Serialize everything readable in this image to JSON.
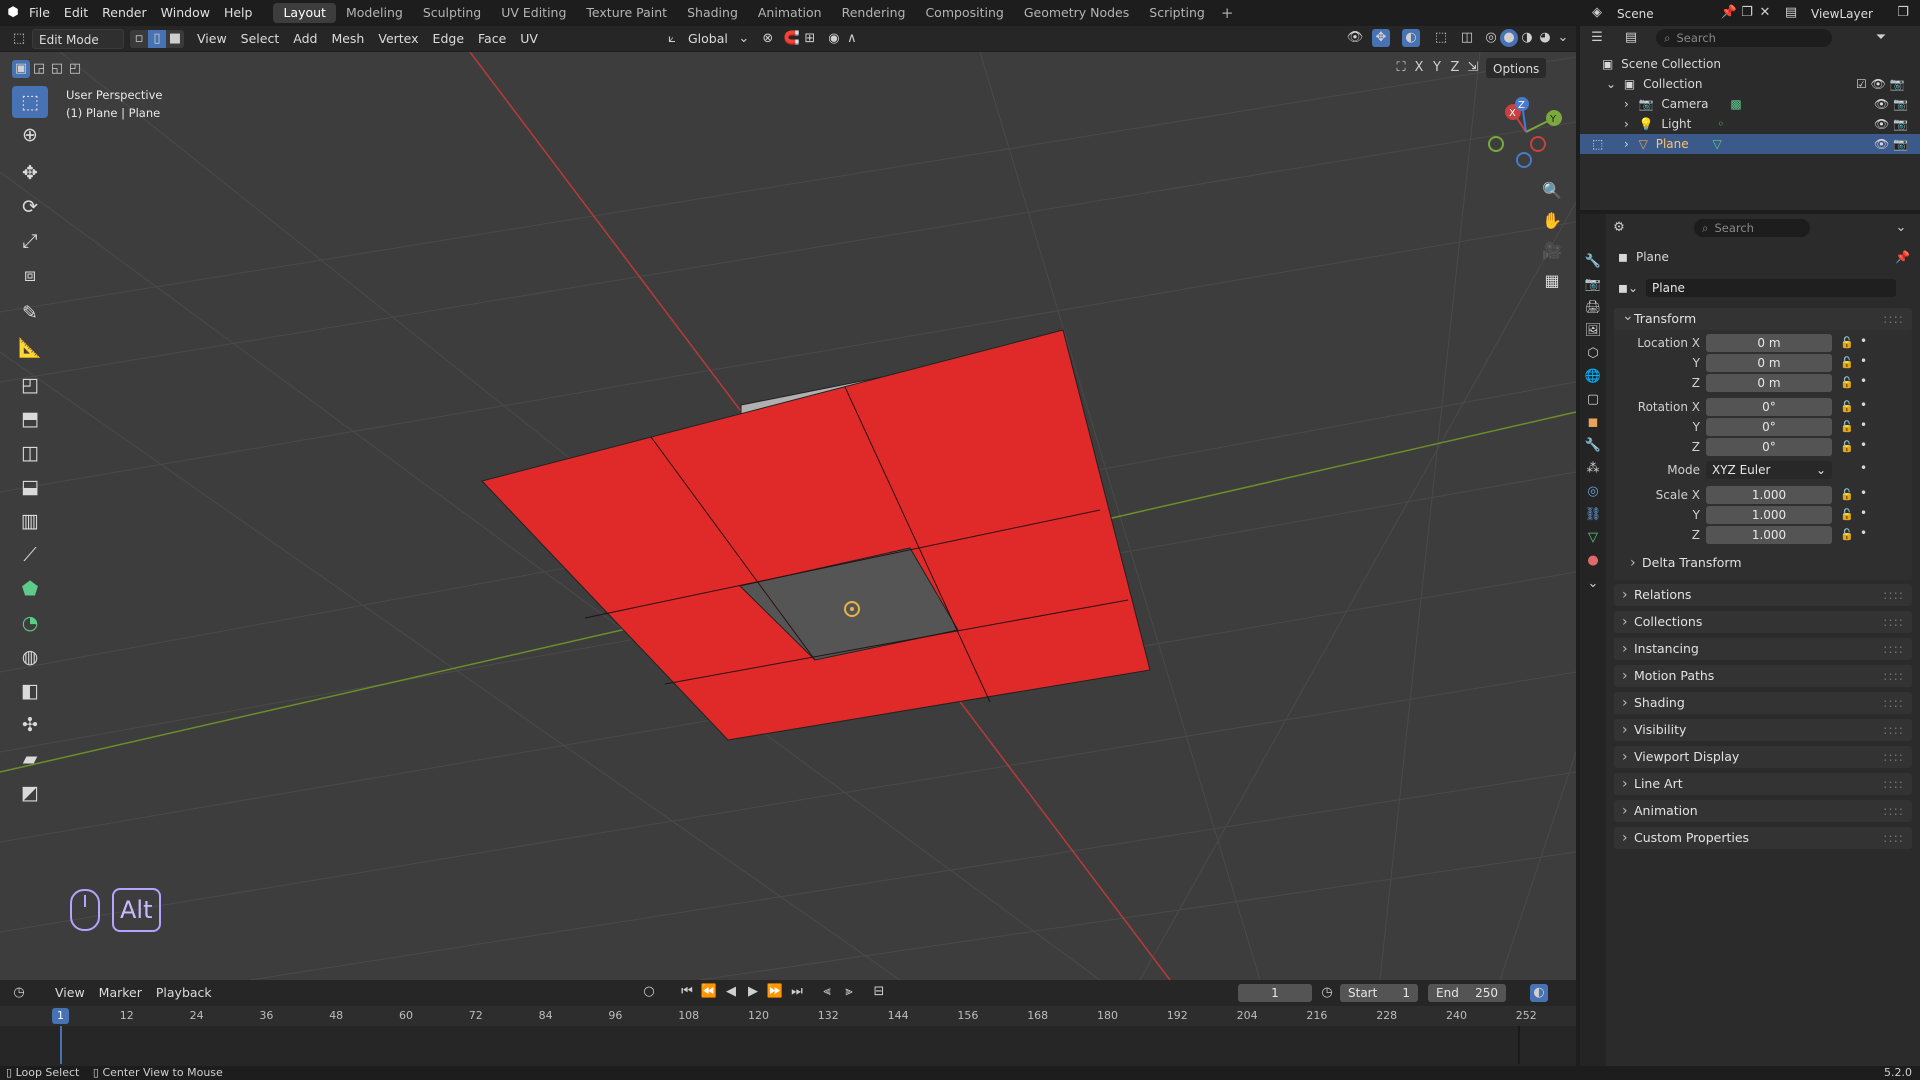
{
  "app": {
    "menus": [
      "File",
      "Edit",
      "Render",
      "Window",
      "Help"
    ],
    "workspaces": [
      "Layout",
      "Modeling",
      "Sculpting",
      "UV Editing",
      "Texture Paint",
      "Shading",
      "Animation",
      "Rendering",
      "Compositing",
      "Geometry Nodes",
      "Scripting"
    ],
    "active_workspace": "Layout",
    "add_tab": "+",
    "scene_label": "Scene",
    "viewlayer_label": "ViewLayer",
    "version": "5.2.0"
  },
  "viewport_header": {
    "mode": "Edit Mode",
    "menus": [
      "View",
      "Select",
      "Add",
      "Mesh",
      "Vertex",
      "Edge",
      "Face",
      "UV"
    ],
    "transform_orientation": "Global",
    "options": "Options",
    "axis_x": "X",
    "axis_y": "Y",
    "axis_z": "Z"
  },
  "viewport": {
    "perspective_label": "User Perspective",
    "object_label": "(1) Plane | Plane",
    "key_hint": "Alt",
    "gizmo": {
      "x": "X",
      "y": "Y",
      "z": "Z"
    },
    "colors": {
      "selected_face": "#e02a2a",
      "x_axis": "#b83a3a",
      "y_axis": "#6a8f2a",
      "grid_bg": "#3d3d3d"
    }
  },
  "outliner": {
    "search_placeholder": "Search",
    "root": "Scene Collection",
    "collection": "Collection",
    "items": [
      {
        "name": "Camera",
        "selected": false
      },
      {
        "name": "Light",
        "selected": false
      },
      {
        "name": "Plane",
        "selected": true
      }
    ]
  },
  "properties": {
    "search_placeholder": "Search",
    "object_name": "Plane",
    "datablock_name": "Plane",
    "transform_title": "Transform",
    "location_label": "Location X",
    "location": [
      "0 m",
      "0 m",
      "0 m"
    ],
    "rotation_label": "Rotation X",
    "rotation": [
      "0°",
      "0°",
      "0°"
    ],
    "mode_label": "Mode",
    "mode_value": "XYZ Euler",
    "scale_label": "Scale X",
    "scale": [
      "1.000",
      "1.000",
      "1.000"
    ],
    "y_label": "Y",
    "z_label": "Z",
    "delta_transform": "Delta Transform",
    "panels": [
      "Relations",
      "Collections",
      "Instancing",
      "Motion Paths",
      "Shading",
      "Visibility",
      "Viewport Display",
      "Line Art",
      "Animation",
      "Custom Properties"
    ]
  },
  "timeline": {
    "menus": [
      "View",
      "Marker",
      "Playback"
    ],
    "current_frame": "1",
    "start_label": "Start",
    "start_value": "1",
    "end_label": "End",
    "end_value": "250",
    "ticks": [
      "1",
      "12",
      "24",
      "36",
      "48",
      "60",
      "72",
      "84",
      "96",
      "108",
      "120",
      "132",
      "144",
      "156",
      "168",
      "180",
      "192",
      "204",
      "216",
      "228",
      "240",
      "252"
    ]
  },
  "status_bar": {
    "hint1": "Loop Select",
    "hint2": "Center View to Mouse"
  }
}
